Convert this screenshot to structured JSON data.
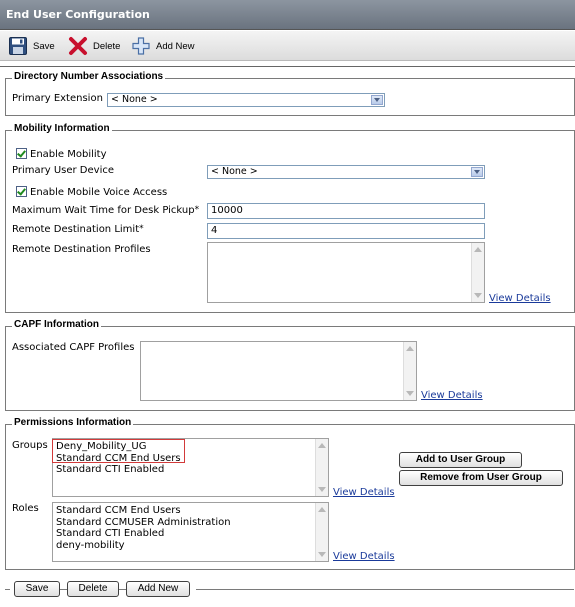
{
  "title": "End User Configuration",
  "toolbar": {
    "save_label": "Save",
    "delete_label": "Delete",
    "add_new_label": "Add New"
  },
  "directory": {
    "legend": "Directory Number Associations",
    "primary_extension_label": "Primary Extension",
    "primary_extension_value": "< None >"
  },
  "mobility": {
    "legend": "Mobility Information",
    "enable_mobility_label": "Enable Mobility",
    "enable_mobility_checked": true,
    "primary_user_device_label": "Primary User Device",
    "primary_user_device_value": "< None >",
    "enable_mobile_voice_label": "Enable Mobile Voice Access",
    "enable_mobile_voice_checked": true,
    "max_wait_label": "Maximum Wait Time for Desk Pickup",
    "max_wait_value": "10000",
    "remote_dest_limit_label": "Remote Destination Limit",
    "remote_dest_limit_value": "4",
    "remote_dest_profiles_label": "Remote Destination Profiles",
    "view_details": "View Details"
  },
  "capf": {
    "legend": "CAPF Information",
    "assoc_label": "Associated CAPF Profiles",
    "view_details": "View Details"
  },
  "permissions": {
    "legend": "Permissions Information",
    "groups_label": "Groups",
    "groups": [
      "Deny_Mobility_UG",
      "Standard CCM End Users",
      "Standard CTI Enabled"
    ],
    "groups_view_details": "View Details",
    "add_group_label": "Add to User Group",
    "remove_group_label": "Remove from User Group",
    "roles_label": "Roles",
    "roles": [
      "Standard CCM End Users",
      "Standard CCMUSER Administration",
      "Standard CTI Enabled",
      "deny-mobility"
    ],
    "roles_view_details": "View Details"
  },
  "footer": {
    "save_label": "Save",
    "delete_label": "Delete",
    "add_new_label": "Add New"
  },
  "required_marker": "*"
}
